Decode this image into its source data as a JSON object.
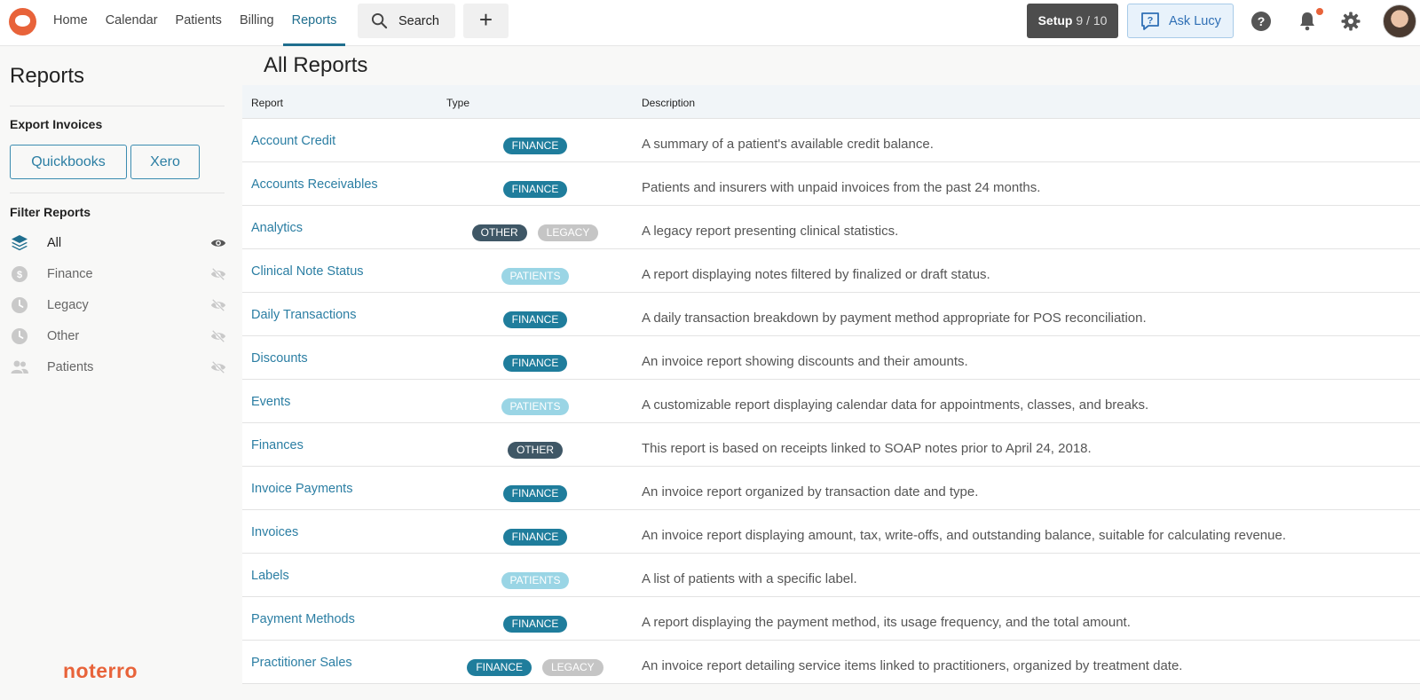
{
  "nav": {
    "items": [
      {
        "label": "Home",
        "active": false
      },
      {
        "label": "Calendar",
        "active": false
      },
      {
        "label": "Patients",
        "active": false
      },
      {
        "label": "Billing",
        "active": false
      },
      {
        "label": "Reports",
        "active": true
      }
    ],
    "search_label": "Search",
    "plus_label": "+",
    "setup_label": "Setup",
    "setup_count": "9 / 10",
    "ask_lucy_label": "Ask Lucy",
    "help_label": "?"
  },
  "sidebar": {
    "title": "Reports",
    "export_heading": "Export Invoices",
    "export_buttons": [
      "Quickbooks",
      "Xero"
    ],
    "filter_heading": "Filter Reports",
    "filters": [
      {
        "label": "All",
        "icon": "layers-icon",
        "visible": true
      },
      {
        "label": "Finance",
        "icon": "dollar-icon",
        "visible": false
      },
      {
        "label": "Legacy",
        "icon": "clock-icon",
        "visible": false
      },
      {
        "label": "Other",
        "icon": "clock-icon",
        "visible": false
      },
      {
        "label": "Patients",
        "icon": "people-icon",
        "visible": false
      }
    ],
    "brand": "noterro"
  },
  "main": {
    "title": "All Reports",
    "columns": [
      "Report",
      "Type",
      "Description"
    ],
    "rows": [
      {
        "name": "Account Credit",
        "types": [
          "FINANCE"
        ],
        "description": "A summary of a patient's available credit balance."
      },
      {
        "name": "Accounts Receivables",
        "types": [
          "FINANCE"
        ],
        "description": "Patients and insurers with unpaid invoices from the past 24 months."
      },
      {
        "name": "Analytics",
        "types": [
          "OTHER",
          "LEGACY"
        ],
        "description": "A legacy report presenting clinical statistics."
      },
      {
        "name": "Clinical Note Status",
        "types": [
          "PATIENTS"
        ],
        "description": "A report displaying notes filtered by finalized or draft status."
      },
      {
        "name": "Daily Transactions",
        "types": [
          "FINANCE"
        ],
        "description": "A daily transaction breakdown by payment method appropriate for POS reconciliation."
      },
      {
        "name": "Discounts",
        "types": [
          "FINANCE"
        ],
        "description": "An invoice report showing discounts and their amounts."
      },
      {
        "name": "Events",
        "types": [
          "PATIENTS"
        ],
        "description": "A customizable report displaying calendar data for appointments, classes, and breaks."
      },
      {
        "name": "Finances",
        "types": [
          "OTHER"
        ],
        "description": "This report is based on receipts linked to SOAP notes prior to April 24, 2018."
      },
      {
        "name": "Invoice Payments",
        "types": [
          "FINANCE"
        ],
        "description": "An invoice report organized by transaction date and type."
      },
      {
        "name": "Invoices",
        "types": [
          "FINANCE"
        ],
        "description": "An invoice report displaying amount, tax, write-offs, and outstanding balance, suitable for calculating revenue."
      },
      {
        "name": "Labels",
        "types": [
          "PATIENTS"
        ],
        "description": "A list of patients with a specific label."
      },
      {
        "name": "Payment Methods",
        "types": [
          "FINANCE"
        ],
        "description": "A report displaying the payment method, its usage frequency, and the total amount."
      },
      {
        "name": "Practitioner Sales",
        "types": [
          "FINANCE",
          "LEGACY"
        ],
        "description": "An invoice report detailing service items linked to practitioners, organized by treatment date."
      }
    ]
  },
  "colors": {
    "accent": "#2b7ea3",
    "brand": "#e8633a",
    "finance_badge": "#1f7d9c",
    "other_badge": "#3f5766",
    "legacy_badge": "#c5c5c5",
    "patients_badge": "#9ad5e5"
  }
}
